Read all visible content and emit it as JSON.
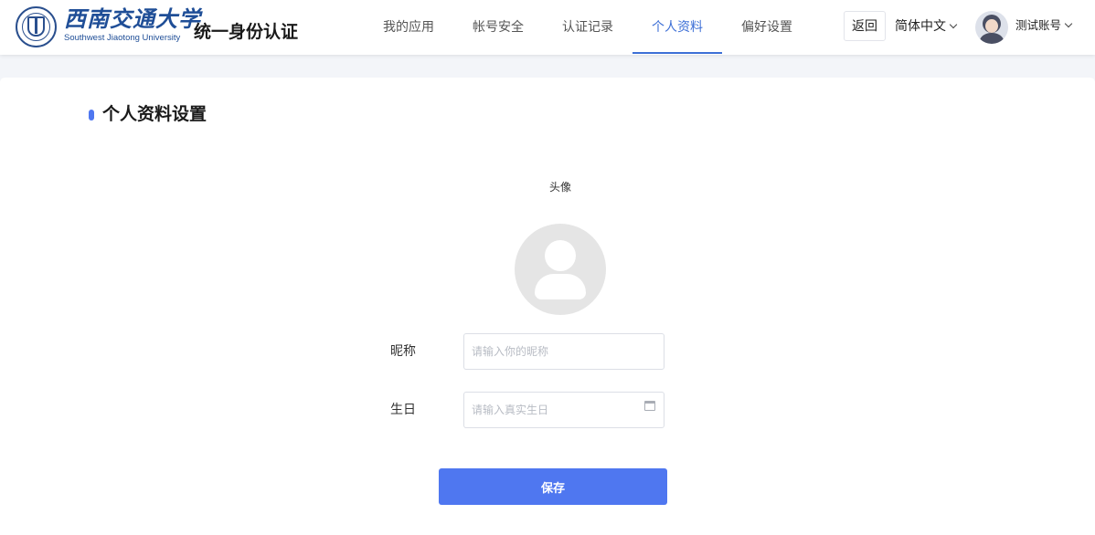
{
  "header": {
    "logo_name": "西南交通大学",
    "logo_sub": "Southwest Jiaotong University",
    "system_title": "统一身份认证",
    "nav": [
      {
        "label": "我的应用",
        "active": false
      },
      {
        "label": "帐号安全",
        "active": false
      },
      {
        "label": "认证记录",
        "active": false
      },
      {
        "label": "个人资料",
        "active": true
      },
      {
        "label": "偏好设置",
        "active": false
      }
    ],
    "back_label": "返回",
    "language": "简体中文",
    "user_name": "测试账号"
  },
  "profile": {
    "section_title": "个人资料设置",
    "avatar_label": "头像",
    "nickname_label": "昵称",
    "nickname_placeholder": "请输入你的昵称",
    "nickname_value": "",
    "birthday_label": "生日",
    "birthday_placeholder": "请输入真实生日",
    "birthday_value": "",
    "save_label": "保存"
  },
  "colors": {
    "accent": "#4f77f0",
    "nav_active": "#3d6fd6",
    "brand": "#1f4e97",
    "page_bg": "#f3f5f9"
  },
  "icons": {
    "logo": "university-seal-icon",
    "language_dropdown": "chevron-down-icon",
    "user_dropdown": "chevron-down-icon",
    "avatar": "user-avatar-icon",
    "avatar_placeholder": "default-avatar-icon",
    "birthday_picker": "calendar-icon"
  }
}
